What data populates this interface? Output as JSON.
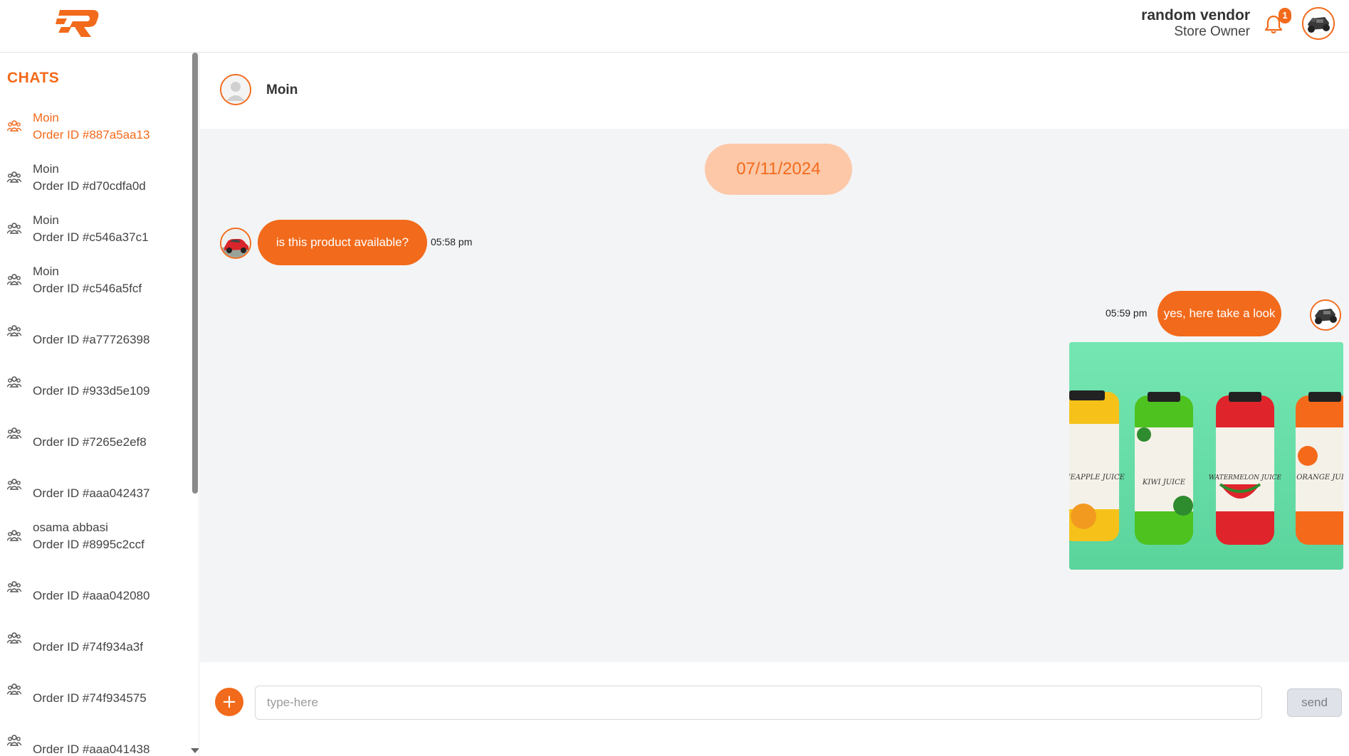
{
  "header": {
    "user_name": "random vendor",
    "user_role": "Store Owner",
    "notification_count": "1",
    "logo_icon": "brand-r-logo",
    "bell_icon": "bell-icon",
    "avatar_icon": "rc-car-avatar"
  },
  "sidebar": {
    "title": "CHATS",
    "items": [
      {
        "name": "Moin",
        "order": "Order ID #887a5aa13",
        "active": true
      },
      {
        "name": "Moin",
        "order": "Order ID #d70cdfa0d"
      },
      {
        "name": "Moin",
        "order": "Order ID #c546a37c1"
      },
      {
        "name": "Moin",
        "order": "Order ID #c546a5fcf"
      },
      {
        "name": "",
        "order": "Order ID #a77726398"
      },
      {
        "name": "",
        "order": "Order ID #933d5e109"
      },
      {
        "name": "",
        "order": "Order ID #7265e2ef8"
      },
      {
        "name": "",
        "order": "Order ID #aaa042437"
      },
      {
        "name": "osama abbasi",
        "order": "Order ID #8995c2ccf"
      },
      {
        "name": "",
        "order": "Order ID #aaa042080"
      },
      {
        "name": "",
        "order": "Order ID #74f934a3f"
      },
      {
        "name": "",
        "order": "Order ID #74f934575"
      },
      {
        "name": "",
        "order": "Order ID #aaa041438"
      }
    ]
  },
  "chat": {
    "contact_name": "Moin",
    "date": "07/11/2024",
    "messages": [
      {
        "direction": "incoming",
        "text": "is this product available?",
        "time": "05:58 pm"
      },
      {
        "direction": "outgoing",
        "text": "yes, here take a look",
        "time": "05:59 pm"
      }
    ],
    "image_labels": [
      "PINEAPPLE JUICE",
      "KIWI JUICE",
      "WATERMELON JUICE",
      "ORANGE JUICE"
    ]
  },
  "composer": {
    "placeholder": "type-here",
    "send_label": "send",
    "add_label": "+"
  },
  "colors": {
    "accent": "#f26a1b",
    "date_pill": "#fcc8a8",
    "background": "#f3f4f6"
  }
}
